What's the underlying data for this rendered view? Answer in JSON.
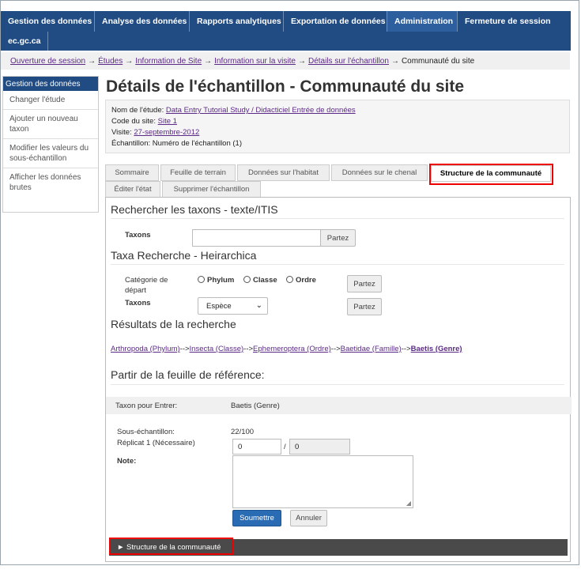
{
  "nav": {
    "items": [
      "Gestion des données",
      "Analyse des données",
      "Rapports analytiques",
      "Exportation de données",
      "Administration",
      "Fermeture de session"
    ],
    "active_index": 4,
    "extra": "ec.gc.ca"
  },
  "breadcrumb": [
    "Ouverture de session",
    "Études",
    "Information de Site",
    "Information sur la visite",
    "Détails sur l'échantillon",
    "Communauté du site"
  ],
  "breadcrumb_sep": "→",
  "sidebar": {
    "header": "Gestion des données",
    "items": [
      "Changer l'étude",
      "Ajouter un nouveau taxon",
      "Modifier les valeurs du sous-échantillon",
      "Afficher les données brutes"
    ]
  },
  "page_title": "Détails de l'échantillon - Communauté du site",
  "info": {
    "study_label": "Nom de l'étude:",
    "study_value": "Data Entry Tutorial Study / Didacticiel Entrée de données",
    "site_label": "Code du site:",
    "site_value": "Site 1",
    "visit_label": "Visite:",
    "visit_value": "27-septembre-2012",
    "sample_label": "Échantillon:",
    "sample_value": "Numéro de l'échantillon (1)"
  },
  "tabs": [
    "Sommaire",
    "Feuille de terrain",
    "Données sur l'habitat",
    "Données sur le chenal",
    "Structure de la communauté",
    "Éditer l'état",
    "Supprimer l'échantillon"
  ],
  "active_tab": "Structure de la communauté",
  "search_text": {
    "heading": "Rechercher les taxons - texte/ITIS",
    "taxa_label": "Taxons",
    "input_value": "",
    "go": "Partez"
  },
  "hier": {
    "heading": "Taxa Recherche - Heirarchica",
    "start_label": "Catégorie de départ",
    "radios": [
      "Phylum",
      "Classe",
      "Ordre"
    ],
    "go": "Partez",
    "taxa_label": "Taxons",
    "select_value": "Espèce"
  },
  "results": {
    "heading": "Résultats de la recherche",
    "path": [
      "Arthropoda (Phylum)",
      "Insecta (Classe)",
      "Ephemeroptera (Ordre)",
      "Baetidae (Famille)",
      "Baetis (Genre)"
    ],
    "sep": "-->"
  },
  "reference": {
    "heading": "Partir de la feuille de référence:",
    "taxon_label": "Taxon pour Entrer:",
    "taxon_value": "Baetis (Genre)",
    "sub_label": "Sous-échantillon:",
    "sub_value": "22/100",
    "replicate_label": "Réplicat 1 (Nécessaire)",
    "replicate_value": "0",
    "slash": "/",
    "replicate_total": "0",
    "note_label": "Note:",
    "submit": "Soumettre",
    "cancel": "Annuler"
  },
  "community_bar": "► Structure de la communauté"
}
